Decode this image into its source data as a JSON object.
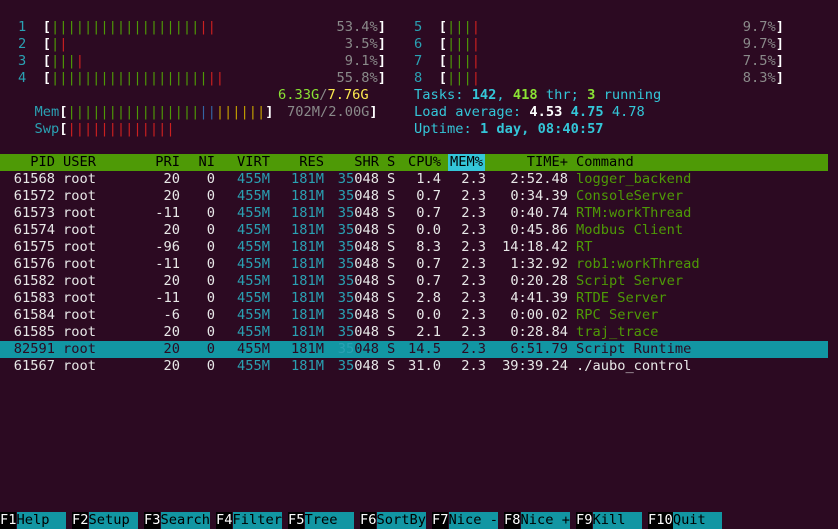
{
  "cpus": [
    {
      "id": "1",
      "bar": "||||||||||||||||||||",
      "pct": "53.4%"
    },
    {
      "id": "2",
      "bar": "||",
      "pct": "3.5%"
    },
    {
      "id": "3",
      "bar": "||||",
      "pct": "9.1%"
    },
    {
      "id": "4",
      "bar": "|||||||||||||||||||||",
      "pct": "55.8%"
    },
    {
      "id": "5",
      "bar": "||||",
      "pct": "9.7%"
    },
    {
      "id": "6",
      "bar": "||||",
      "pct": "9.7%"
    },
    {
      "id": "7",
      "bar": "||||",
      "pct": "7.5%"
    },
    {
      "id": "8",
      "bar": "||||",
      "pct": "8.3%"
    }
  ],
  "mem": {
    "label": "Mem",
    "bar": "||||||||||||||||||||||||",
    "used": "6.33G",
    "total": "7.76G"
  },
  "swp": {
    "label": "Swp",
    "bar": "|||||||||||||",
    "used": "702M",
    "total": "2.00G"
  },
  "tasks": {
    "label": "Tasks: ",
    "count": "142",
    "thr_count": "418",
    "thr_label": " thr; ",
    "running": "3",
    "running_label": " running"
  },
  "load": {
    "label": "Load average: ",
    "l1": "4.53",
    "l5": "4.75",
    "l15": "4.78"
  },
  "uptime": {
    "label": "Uptime: ",
    "value": "1 day, 08:40:57"
  },
  "columns": [
    "PID",
    "USER",
    "PRI",
    "NI",
    "VIRT",
    "RES",
    "SHR",
    "S",
    "CPU%",
    "MEM%",
    "TIME+",
    "Command"
  ],
  "processes": [
    {
      "pid": "61568",
      "user": "root",
      "pri": "20",
      "ni": "0",
      "virt": "455M",
      "res": "181M",
      "shr": "35048",
      "s": "S",
      "cpu": "1.4",
      "mem": "2.3",
      "time": "2:52.48",
      "cmd": "logger_backend"
    },
    {
      "pid": "61572",
      "user": "root",
      "pri": "20",
      "ni": "0",
      "virt": "455M",
      "res": "181M",
      "shr": "35048",
      "s": "S",
      "cpu": "0.7",
      "mem": "2.3",
      "time": "0:34.39",
      "cmd": "ConsoleServer"
    },
    {
      "pid": "61573",
      "user": "root",
      "pri": "-11",
      "ni": "0",
      "virt": "455M",
      "res": "181M",
      "shr": "35048",
      "s": "S",
      "cpu": "0.7",
      "mem": "2.3",
      "time": "0:40.74",
      "cmd": "RTM:workThread"
    },
    {
      "pid": "61574",
      "user": "root",
      "pri": "20",
      "ni": "0",
      "virt": "455M",
      "res": "181M",
      "shr": "35048",
      "s": "S",
      "cpu": "0.0",
      "mem": "2.3",
      "time": "0:45.86",
      "cmd": "Modbus Client"
    },
    {
      "pid": "61575",
      "user": "root",
      "pri": "-96",
      "ni": "0",
      "virt": "455M",
      "res": "181M",
      "shr": "35048",
      "s": "S",
      "cpu": "8.3",
      "mem": "2.3",
      "time": "14:18.42",
      "cmd": "RT"
    },
    {
      "pid": "61576",
      "user": "root",
      "pri": "-11",
      "ni": "0",
      "virt": "455M",
      "res": "181M",
      "shr": "35048",
      "s": "S",
      "cpu": "0.7",
      "mem": "2.3",
      "time": "1:32.92",
      "cmd": "rob1:workThread"
    },
    {
      "pid": "61582",
      "user": "root",
      "pri": "20",
      "ni": "0",
      "virt": "455M",
      "res": "181M",
      "shr": "35048",
      "s": "S",
      "cpu": "0.7",
      "mem": "2.3",
      "time": "0:20.28",
      "cmd": "Script Server"
    },
    {
      "pid": "61583",
      "user": "root",
      "pri": "-11",
      "ni": "0",
      "virt": "455M",
      "res": "181M",
      "shr": "35048",
      "s": "S",
      "cpu": "2.8",
      "mem": "2.3",
      "time": "4:41.39",
      "cmd": "RTDE Server"
    },
    {
      "pid": "61584",
      "user": "root",
      "pri": "-6",
      "ni": "0",
      "virt": "455M",
      "res": "181M",
      "shr": "35048",
      "s": "S",
      "cpu": "0.0",
      "mem": "2.3",
      "time": "0:00.02",
      "cmd": "RPC Server"
    },
    {
      "pid": "61585",
      "user": "root",
      "pri": "20",
      "ni": "0",
      "virt": "455M",
      "res": "181M",
      "shr": "35048",
      "s": "S",
      "cpu": "2.1",
      "mem": "2.3",
      "time": "0:28.84",
      "cmd": "traj_trace"
    },
    {
      "pid": "82591",
      "user": "root",
      "pri": "20",
      "ni": "0",
      "virt": "455M",
      "res": "181M",
      "shr": "35048",
      "s": "S",
      "cpu": "14.5",
      "mem": "2.3",
      "time": "6:51.79",
      "cmd": "Script Runtime",
      "selected": true
    },
    {
      "pid": "61567",
      "user": "root",
      "pri": "20",
      "ni": "0",
      "virt": "455M",
      "res": "181M",
      "shr": "35048",
      "s": "S",
      "cpu": "31.0",
      "mem": "2.3",
      "time": "39:39.24",
      "cmd": "./aubo_control",
      "main": true
    }
  ],
  "fkeys": [
    {
      "key": "F1",
      "label": "Help  "
    },
    {
      "key": "F2",
      "label": "Setup "
    },
    {
      "key": "F3",
      "label": "Search"
    },
    {
      "key": "F4",
      "label": "Filter"
    },
    {
      "key": "F5",
      "label": "Tree  "
    },
    {
      "key": "F6",
      "label": "SortBy"
    },
    {
      "key": "F7",
      "label": "Nice -"
    },
    {
      "key": "F8",
      "label": "Nice +"
    },
    {
      "key": "F9",
      "label": "Kill  "
    },
    {
      "key": "F10",
      "label": "Quit  "
    }
  ],
  "colors": {
    "bg": "#2c0a22",
    "green": "#4e9a06",
    "cyan": "#34c6d8",
    "teal": "#1296a3",
    "red": "#cc2020"
  }
}
